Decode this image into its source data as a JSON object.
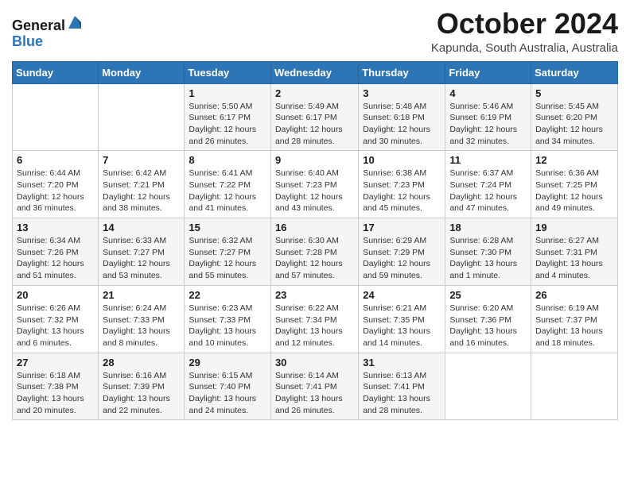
{
  "header": {
    "logo_line1": "General",
    "logo_line2": "Blue",
    "month": "October 2024",
    "location": "Kapunda, South Australia, Australia"
  },
  "days_of_week": [
    "Sunday",
    "Monday",
    "Tuesday",
    "Wednesday",
    "Thursday",
    "Friday",
    "Saturday"
  ],
  "weeks": [
    [
      {
        "day": "",
        "info": ""
      },
      {
        "day": "",
        "info": ""
      },
      {
        "day": "1",
        "info": "Sunrise: 5:50 AM\nSunset: 6:17 PM\nDaylight: 12 hours and 26 minutes."
      },
      {
        "day": "2",
        "info": "Sunrise: 5:49 AM\nSunset: 6:17 PM\nDaylight: 12 hours and 28 minutes."
      },
      {
        "day": "3",
        "info": "Sunrise: 5:48 AM\nSunset: 6:18 PM\nDaylight: 12 hours and 30 minutes."
      },
      {
        "day": "4",
        "info": "Sunrise: 5:46 AM\nSunset: 6:19 PM\nDaylight: 12 hours and 32 minutes."
      },
      {
        "day": "5",
        "info": "Sunrise: 5:45 AM\nSunset: 6:20 PM\nDaylight: 12 hours and 34 minutes."
      }
    ],
    [
      {
        "day": "6",
        "info": "Sunrise: 6:44 AM\nSunset: 7:20 PM\nDaylight: 12 hours and 36 minutes."
      },
      {
        "day": "7",
        "info": "Sunrise: 6:42 AM\nSunset: 7:21 PM\nDaylight: 12 hours and 38 minutes."
      },
      {
        "day": "8",
        "info": "Sunrise: 6:41 AM\nSunset: 7:22 PM\nDaylight: 12 hours and 41 minutes."
      },
      {
        "day": "9",
        "info": "Sunrise: 6:40 AM\nSunset: 7:23 PM\nDaylight: 12 hours and 43 minutes."
      },
      {
        "day": "10",
        "info": "Sunrise: 6:38 AM\nSunset: 7:23 PM\nDaylight: 12 hours and 45 minutes."
      },
      {
        "day": "11",
        "info": "Sunrise: 6:37 AM\nSunset: 7:24 PM\nDaylight: 12 hours and 47 minutes."
      },
      {
        "day": "12",
        "info": "Sunrise: 6:36 AM\nSunset: 7:25 PM\nDaylight: 12 hours and 49 minutes."
      }
    ],
    [
      {
        "day": "13",
        "info": "Sunrise: 6:34 AM\nSunset: 7:26 PM\nDaylight: 12 hours and 51 minutes."
      },
      {
        "day": "14",
        "info": "Sunrise: 6:33 AM\nSunset: 7:27 PM\nDaylight: 12 hours and 53 minutes."
      },
      {
        "day": "15",
        "info": "Sunrise: 6:32 AM\nSunset: 7:27 PM\nDaylight: 12 hours and 55 minutes."
      },
      {
        "day": "16",
        "info": "Sunrise: 6:30 AM\nSunset: 7:28 PM\nDaylight: 12 hours and 57 minutes."
      },
      {
        "day": "17",
        "info": "Sunrise: 6:29 AM\nSunset: 7:29 PM\nDaylight: 12 hours and 59 minutes."
      },
      {
        "day": "18",
        "info": "Sunrise: 6:28 AM\nSunset: 7:30 PM\nDaylight: 13 hours and 1 minute."
      },
      {
        "day": "19",
        "info": "Sunrise: 6:27 AM\nSunset: 7:31 PM\nDaylight: 13 hours and 4 minutes."
      }
    ],
    [
      {
        "day": "20",
        "info": "Sunrise: 6:26 AM\nSunset: 7:32 PM\nDaylight: 13 hours and 6 minutes."
      },
      {
        "day": "21",
        "info": "Sunrise: 6:24 AM\nSunset: 7:33 PM\nDaylight: 13 hours and 8 minutes."
      },
      {
        "day": "22",
        "info": "Sunrise: 6:23 AM\nSunset: 7:33 PM\nDaylight: 13 hours and 10 minutes."
      },
      {
        "day": "23",
        "info": "Sunrise: 6:22 AM\nSunset: 7:34 PM\nDaylight: 13 hours and 12 minutes."
      },
      {
        "day": "24",
        "info": "Sunrise: 6:21 AM\nSunset: 7:35 PM\nDaylight: 13 hours and 14 minutes."
      },
      {
        "day": "25",
        "info": "Sunrise: 6:20 AM\nSunset: 7:36 PM\nDaylight: 13 hours and 16 minutes."
      },
      {
        "day": "26",
        "info": "Sunrise: 6:19 AM\nSunset: 7:37 PM\nDaylight: 13 hours and 18 minutes."
      }
    ],
    [
      {
        "day": "27",
        "info": "Sunrise: 6:18 AM\nSunset: 7:38 PM\nDaylight: 13 hours and 20 minutes."
      },
      {
        "day": "28",
        "info": "Sunrise: 6:16 AM\nSunset: 7:39 PM\nDaylight: 13 hours and 22 minutes."
      },
      {
        "day": "29",
        "info": "Sunrise: 6:15 AM\nSunset: 7:40 PM\nDaylight: 13 hours and 24 minutes."
      },
      {
        "day": "30",
        "info": "Sunrise: 6:14 AM\nSunset: 7:41 PM\nDaylight: 13 hours and 26 minutes."
      },
      {
        "day": "31",
        "info": "Sunrise: 6:13 AM\nSunset: 7:41 PM\nDaylight: 13 hours and 28 minutes."
      },
      {
        "day": "",
        "info": ""
      },
      {
        "day": "",
        "info": ""
      }
    ]
  ]
}
